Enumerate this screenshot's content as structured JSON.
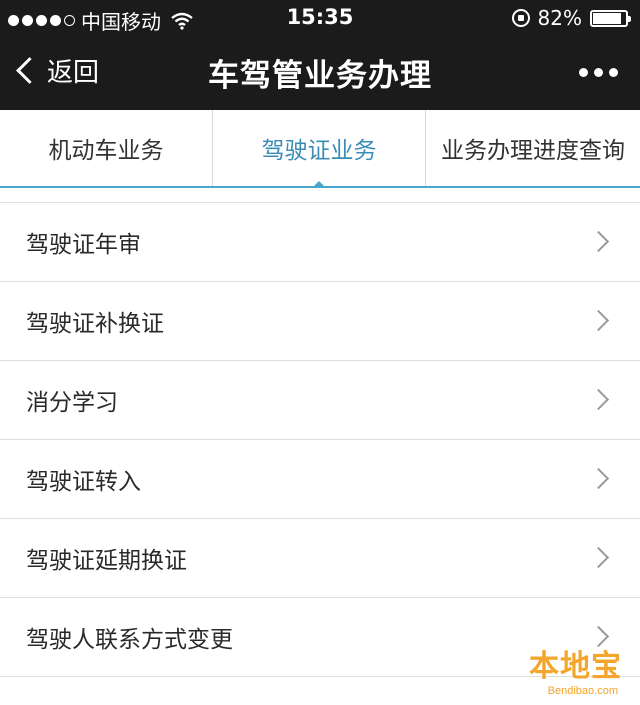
{
  "status_bar": {
    "carrier": "中国移动",
    "time": "15:35",
    "battery": "82%",
    "battery_level": 0.82,
    "signal_bars": 4
  },
  "nav": {
    "back_label": "返回",
    "title": "车驾管业务办理"
  },
  "tabs": [
    {
      "label": "机动车业务",
      "active": false
    },
    {
      "label": "驾驶证业务",
      "active": true
    },
    {
      "label": "业务办理进度查询",
      "active": false
    }
  ],
  "list": {
    "items": [
      {
        "label": "驾驶证年审"
      },
      {
        "label": "驾驶证补换证"
      },
      {
        "label": "消分学习"
      },
      {
        "label": "驾驶证转入"
      },
      {
        "label": "驾驶证延期换证"
      },
      {
        "label": "驾驶人联系方式变更"
      }
    ]
  },
  "watermark": {
    "brand": "本地宝",
    "url": "Bendibao.com"
  },
  "colors": {
    "topbar": "#1b1b1b",
    "accent": "#4aa6c8",
    "active_tab": "#3b8db5",
    "watermark": "#f4a52b"
  }
}
